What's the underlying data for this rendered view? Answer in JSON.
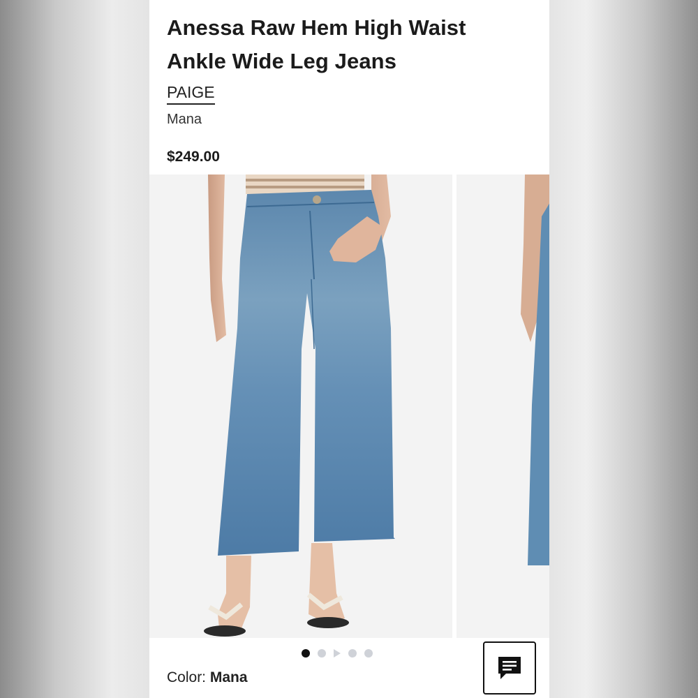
{
  "product": {
    "title": "Anessa Raw Hem High Waist Ankle Wide Leg Jeans",
    "brand": "PAIGE",
    "variant": "Mana",
    "price": "$249.00"
  },
  "gallery": {
    "slides": [
      "jeans-front-photo",
      "jeans-side-photo"
    ],
    "dot_count": 5,
    "active_index": 0
  },
  "color": {
    "label": "Color:",
    "value": "Mana"
  },
  "chat": {
    "icon": "chat-icon"
  }
}
